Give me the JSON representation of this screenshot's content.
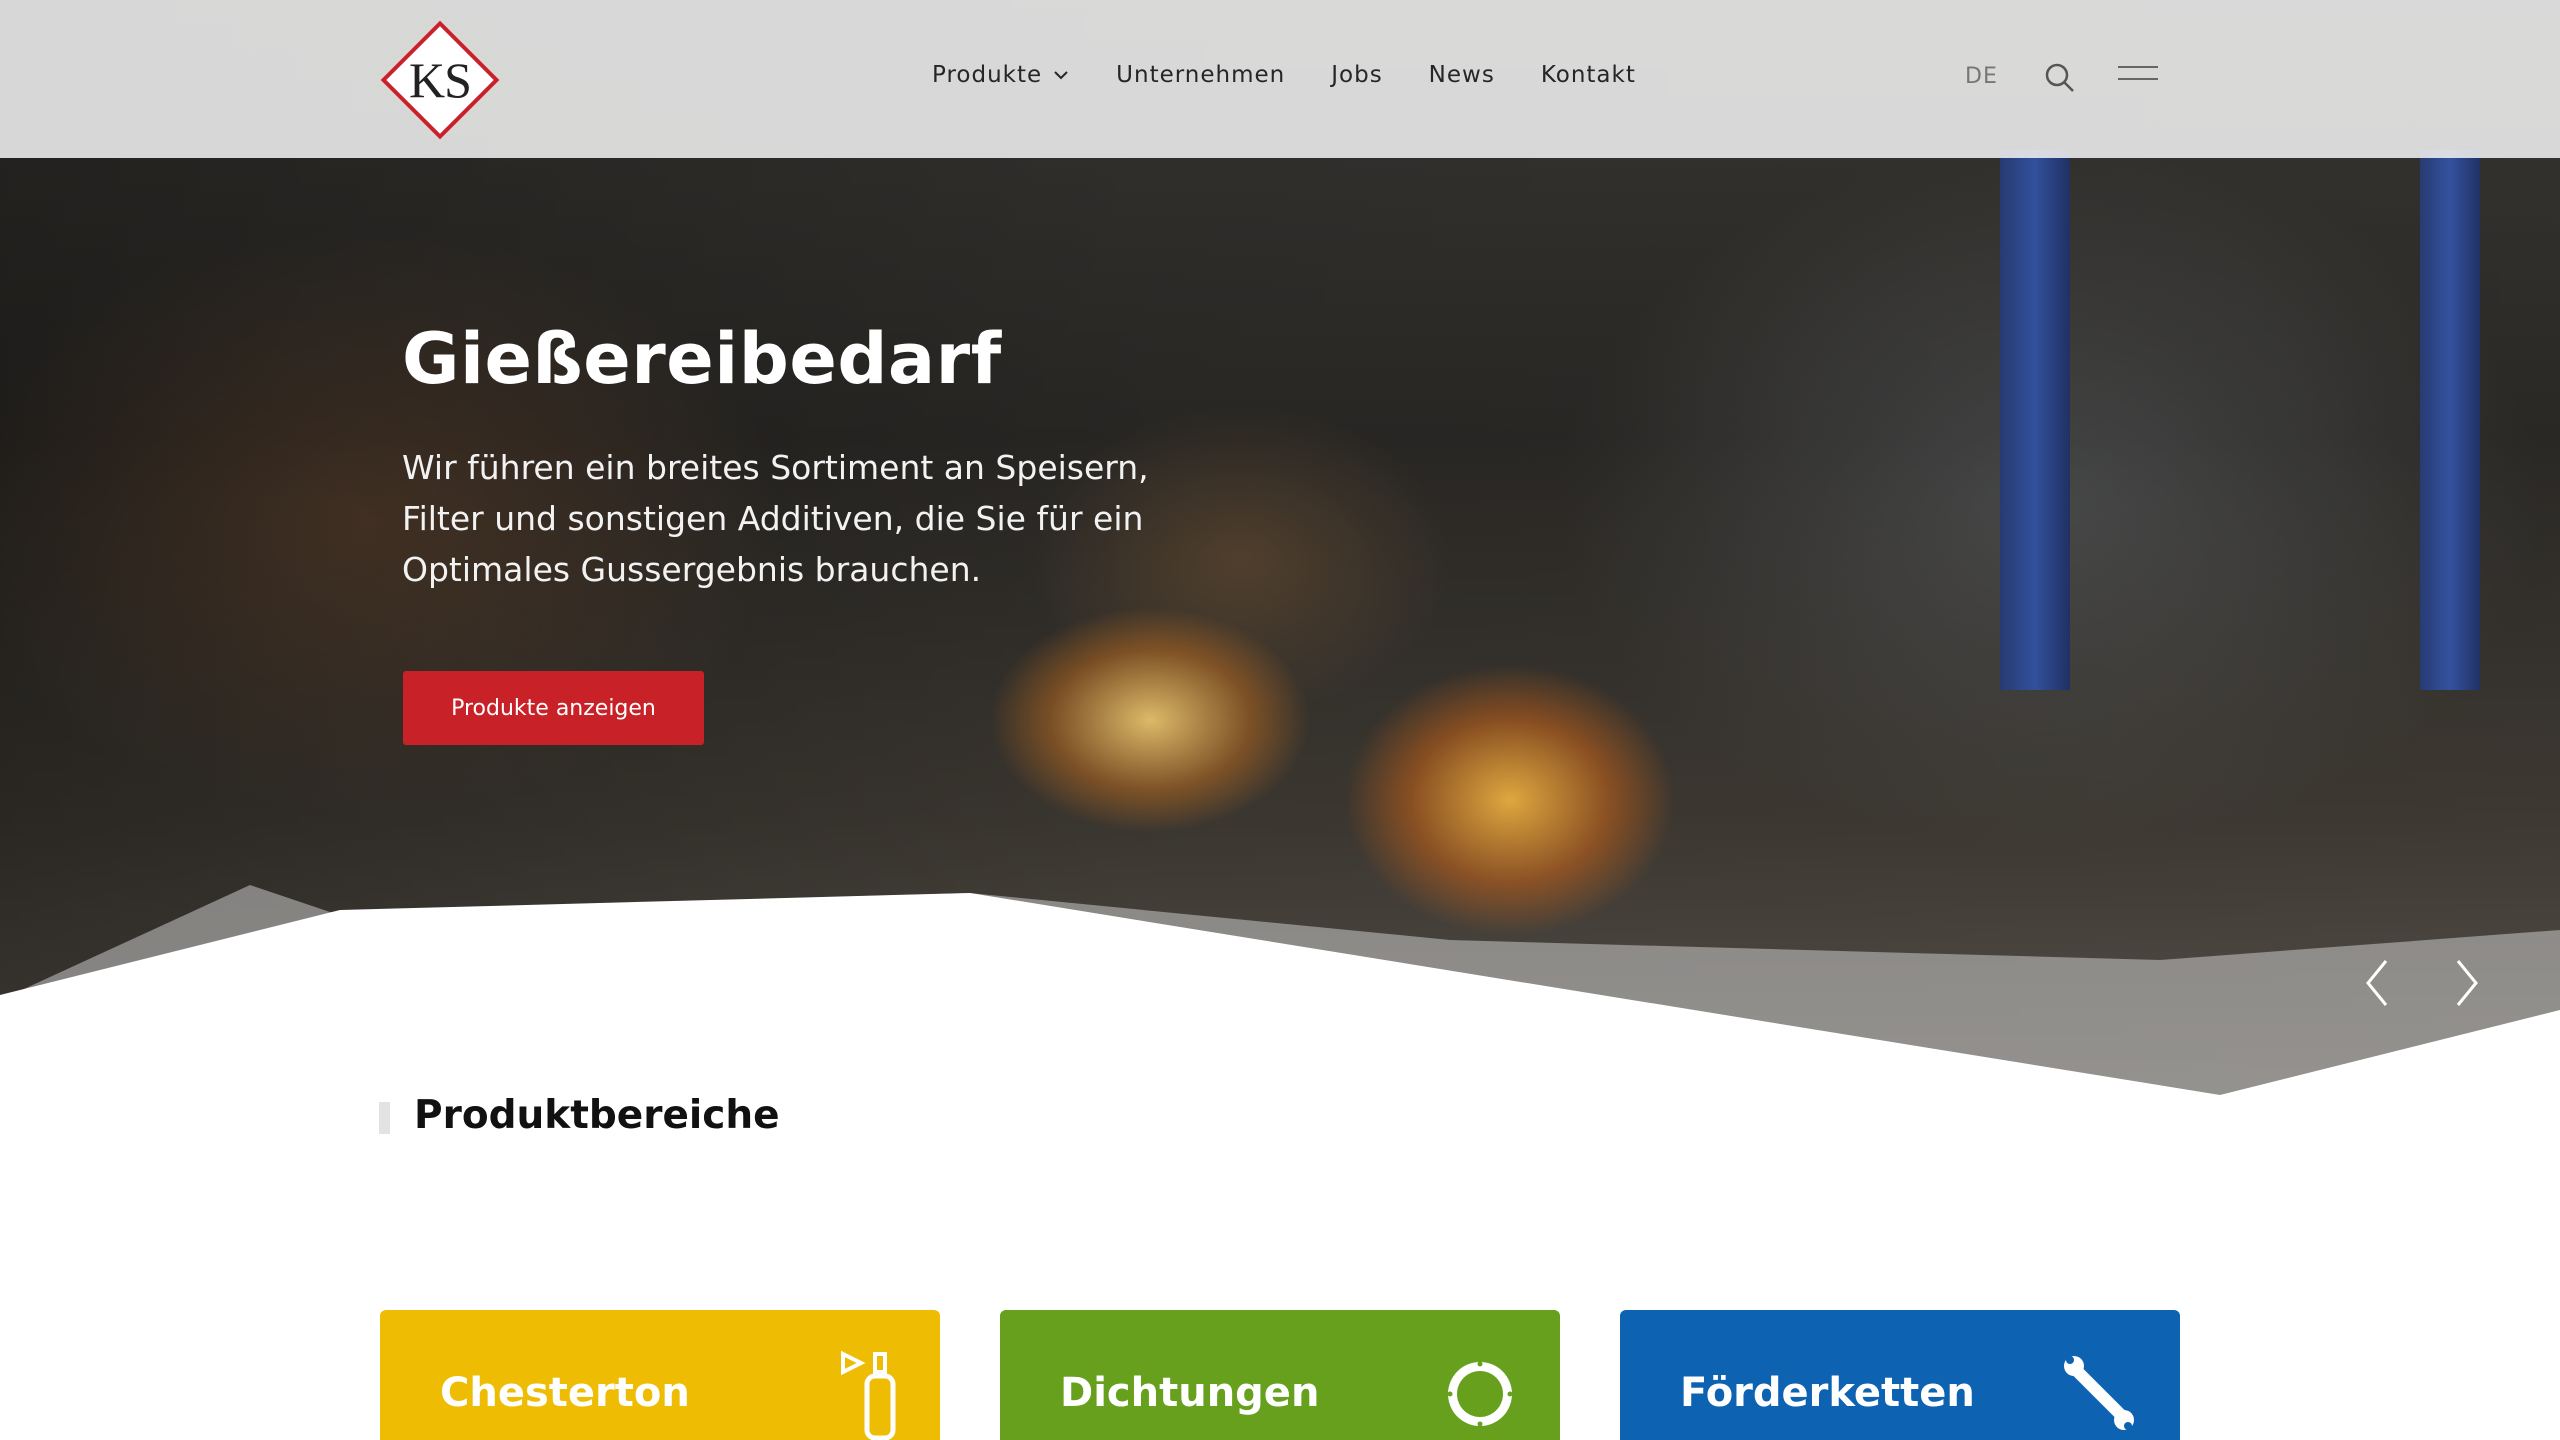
{
  "header": {
    "logo_text": "KS",
    "nav": [
      {
        "label": "Produkte"
      },
      {
        "label": "Unternehmen"
      },
      {
        "label": "Jobs"
      },
      {
        "label": "News"
      },
      {
        "label": "Kontakt"
      }
    ],
    "language": "DE",
    "icons": {
      "search": "search-icon",
      "menu": "hamburger-menu-icon",
      "dropdown": "chevron-down-icon"
    }
  },
  "hero": {
    "title": "Gießereibedarf",
    "text": "Wir führen ein breites Sortiment an Speisern, Filter und sonstigen Additiven, die Sie für ein Optimales Gussergebnis brauchen.",
    "button_label": "Produkte anzeigen",
    "icons": {
      "prev": "chevron-left-icon",
      "next": "chevron-right-icon"
    }
  },
  "section": {
    "title": "Produktbereiche"
  },
  "cards": [
    {
      "title": "Chesterton",
      "color": "#eebd03",
      "icon": "spray-can-icon"
    },
    {
      "title": "Dichtungen",
      "color": "#66a01c",
      "icon": "ring-seal-icon"
    },
    {
      "title": "Förderketten",
      "color": "#0e62b2",
      "icon": "wrench-icon"
    }
  ],
  "colors": {
    "accent_red": "#c92128",
    "header_bg": "#ebebeb"
  }
}
